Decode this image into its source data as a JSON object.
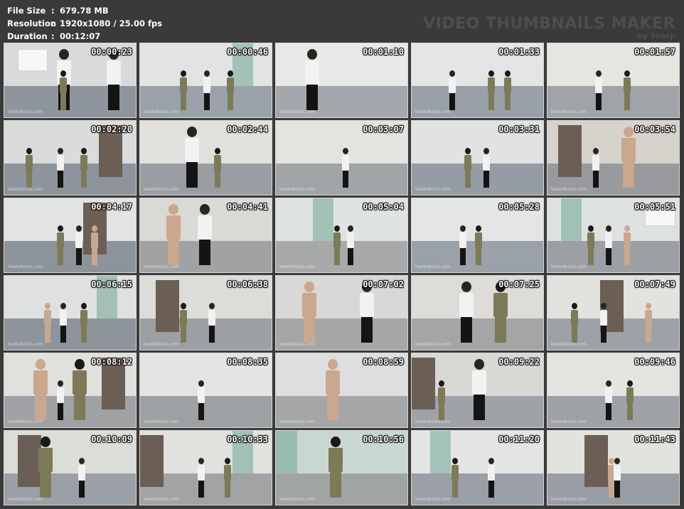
{
  "file_info": {
    "file_size": {
      "label": "File Size",
      "sep": ":",
      "value": "679.78 MB"
    },
    "resolution": {
      "label": "Resolution",
      "sep": ":",
      "value": "1920x1080 / 25.00 fps"
    },
    "duration": {
      "label": "Duration",
      "sep": ":",
      "value": "00:12:07"
    }
  },
  "brand": {
    "title": "VIDEO THUMBNAILS MAKER",
    "subtitle": "by Scorp"
  },
  "colors": {
    "floor": "#9aa0a8",
    "wall": "#e6e7e8",
    "camo": "#7d7a58",
    "black": "#141414",
    "skin": "#caa78f"
  },
  "thumbnails": [
    {
      "time": "00:00:23",
      "wm": "heels4kicks.com",
      "icon": "video-frame-icon"
    },
    {
      "time": "00:00:46",
      "wm": "heels4kicks.com",
      "icon": "video-frame-icon"
    },
    {
      "time": "00:01:10",
      "wm": "heels4kicks.com",
      "icon": "video-frame-icon"
    },
    {
      "time": "00:01:33",
      "wm": "heels4kicks.com",
      "icon": "video-frame-icon"
    },
    {
      "time": "00:01:57",
      "wm": "heels4kicks.com",
      "icon": "video-frame-icon"
    },
    {
      "time": "00:02:20",
      "wm": "heels4kicks.com",
      "icon": "video-frame-icon"
    },
    {
      "time": "00:02:44",
      "wm": "heels4kicks.com",
      "icon": "video-frame-icon"
    },
    {
      "time": "00:03:07",
      "wm": "heels4kicks.com",
      "icon": "video-frame-icon"
    },
    {
      "time": "00:03:31",
      "wm": "heels4kicks.com",
      "icon": "video-frame-icon"
    },
    {
      "time": "00:03:54",
      "wm": "heels4kicks.com",
      "icon": "video-frame-icon"
    },
    {
      "time": "00:04:17",
      "wm": "heels4kicks.com",
      "icon": "video-frame-icon"
    },
    {
      "time": "00:04:41",
      "wm": "heels4kicks.com",
      "icon": "video-frame-icon"
    },
    {
      "time": "00:05:04",
      "wm": "heels4kicks.com",
      "icon": "video-frame-icon"
    },
    {
      "time": "00:05:28",
      "wm": "heels4kicks.com",
      "icon": "video-frame-icon"
    },
    {
      "time": "00:05:51",
      "wm": "heels4kicks.com",
      "icon": "video-frame-icon"
    },
    {
      "time": "00:06:15",
      "wm": "heels4kicks.com",
      "icon": "video-frame-icon"
    },
    {
      "time": "00:06:38",
      "wm": "heels4kicks.com",
      "icon": "video-frame-icon"
    },
    {
      "time": "00:07:02",
      "wm": "heels4kicks.com",
      "icon": "video-frame-icon"
    },
    {
      "time": "00:07:25",
      "wm": "heels4kicks.com",
      "icon": "video-frame-icon"
    },
    {
      "time": "00:07:49",
      "wm": "heels4kicks.com",
      "icon": "video-frame-icon"
    },
    {
      "time": "00:08:12",
      "wm": "heels4kicks.com",
      "icon": "video-frame-icon"
    },
    {
      "time": "00:08:35",
      "wm": "heels4kicks.com",
      "icon": "video-frame-icon"
    },
    {
      "time": "00:08:59",
      "wm": "heels4kicks.com",
      "icon": "video-frame-icon"
    },
    {
      "time": "00:09:22",
      "wm": "heels4kicks.com",
      "icon": "video-frame-icon"
    },
    {
      "time": "00:09:46",
      "wm": "heels4kicks.com",
      "icon": "video-frame-icon"
    },
    {
      "time": "00:10:09",
      "wm": "heels4kicks.com",
      "icon": "video-frame-icon"
    },
    {
      "time": "00:10:33",
      "wm": "heels4kicks.com",
      "icon": "video-frame-icon"
    },
    {
      "time": "00:10:56",
      "wm": "heels4kicks.com",
      "icon": "video-frame-icon"
    },
    {
      "time": "00:11:20",
      "wm": "heels4kicks.com",
      "icon": "video-frame-icon"
    },
    {
      "time": "00:11:43",
      "wm": "heels4kicks.com",
      "icon": "video-frame-icon"
    }
  ]
}
